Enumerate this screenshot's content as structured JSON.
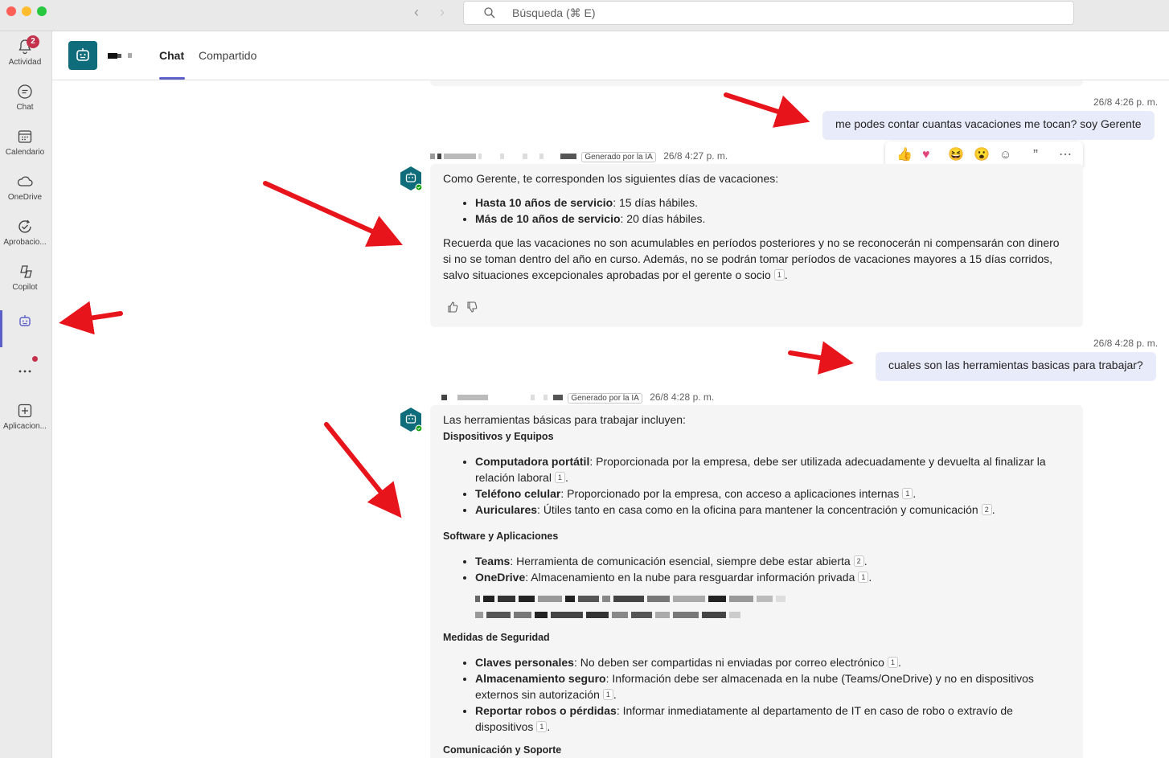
{
  "search": {
    "placeholder": "Búsqueda (⌘ E)"
  },
  "rail": {
    "items": [
      {
        "label": "Actividad",
        "icon": "bell-icon",
        "badge": "2"
      },
      {
        "label": "Chat",
        "icon": "chat-icon"
      },
      {
        "label": "Calendario",
        "icon": "calendar-icon"
      },
      {
        "label": "OneDrive",
        "icon": "cloud-icon"
      },
      {
        "label": "Aprobacio...",
        "icon": "approvals-icon"
      },
      {
        "label": "Copilot",
        "icon": "copilot-icon"
      },
      {
        "label": "",
        "icon": "bot-icon"
      },
      {
        "label": "",
        "icon": "more-icon"
      },
      {
        "label": "Aplicacion...",
        "icon": "add-app-icon"
      }
    ]
  },
  "header": {
    "tabs": [
      {
        "label": "Chat",
        "active": true
      },
      {
        "label": "Compartido",
        "active": false
      }
    ]
  },
  "messages": [
    {
      "from": "user",
      "timestamp": "26/8 4:26 p. m.",
      "text": "me podes contar cuantas vacaciones me tocan? soy Gerente"
    },
    {
      "from": "bot",
      "ai_tag": "Generado por la IA",
      "timestamp": "26/8 4:27 p. m.",
      "intro": "Como Gerente, te corresponden los siguientes días de vacaciones:",
      "items": [
        {
          "bold": "Hasta 10 años de servicio",
          "text": ": 15 días hábiles."
        },
        {
          "bold": "Más de 10 años de servicio",
          "text": ": 20 días hábiles."
        }
      ],
      "paragraph": "Recuerda que las vacaciones no son acumulables en períodos posteriores y no se reconocerán ni compensarán con dinero si no se toman dentro del año en curso. Además, no se podrán tomar períodos de vacaciones mayores a 15 días corridos, salvo situaciones excepcionales aprobadas por el gerente o socio",
      "paragraph_cite": "1",
      "paragraph_end": "."
    },
    {
      "from": "user",
      "timestamp": "26/8 4:28 p. m.",
      "text": "cuales son las herramientas basicas para trabajar?"
    },
    {
      "from": "bot",
      "ai_tag": "Generado por la IA",
      "timestamp": "26/8 4:28 p. m.",
      "intro": "Las herramientas básicas para trabajar incluyen:",
      "sections": [
        {
          "title": "Dispositivos y Equipos",
          "items": [
            {
              "bold": "Computadora portátil",
              "text": ": Proporcionada por la empresa, debe ser utilizada adecuadamente y devuelta al finalizar la relación laboral",
              "cite": "1",
              "end": "."
            },
            {
              "bold": "Teléfono celular",
              "text": ": Proporcionado por la empresa, con acceso a aplicaciones internas",
              "cite": "1",
              "end": "."
            },
            {
              "bold": "Auriculares",
              "text": ": Útiles tanto en casa como en la oficina para mantener la concentración y comunicación",
              "cite": "2",
              "end": "."
            }
          ]
        },
        {
          "title": "Software y Aplicaciones",
          "items": [
            {
              "bold": "Teams",
              "text": ": Herramienta de comunicación esencial, siempre debe estar abierta",
              "cite": "2",
              "end": "."
            },
            {
              "bold": "OneDrive",
              "text": ": Almacenamiento en la nube para resguardar información privada",
              "cite": "1",
              "end": "."
            }
          ]
        },
        {
          "title": "Medidas de Seguridad",
          "items": [
            {
              "bold": "Claves personales",
              "text": ": No deben ser compartidas ni enviadas por correo electrónico",
              "cite": "1",
              "end": "."
            },
            {
              "bold": "Almacenamiento seguro",
              "text": ": Información debe ser almacenada en la nube (Teams/OneDrive) y no en dispositivos externos sin autorización",
              "cite": "1",
              "end": "."
            },
            {
              "bold": "Reportar robos o pérdidas",
              "text": ": Informar inmediatamente al departamento de IT en caso de robo o extravío de dispositivos",
              "cite": "1",
              "end": "."
            }
          ]
        },
        {
          "title": "Comunicación y Soporte",
          "items": []
        }
      ]
    }
  ],
  "colors": {
    "accent": "#5b5fc7",
    "user_bubble": "#e8ebfa",
    "bot_bubble": "#f5f5f5",
    "bot_avatar": "#0f6c7a",
    "annotation_arrow": "#e8141b"
  }
}
